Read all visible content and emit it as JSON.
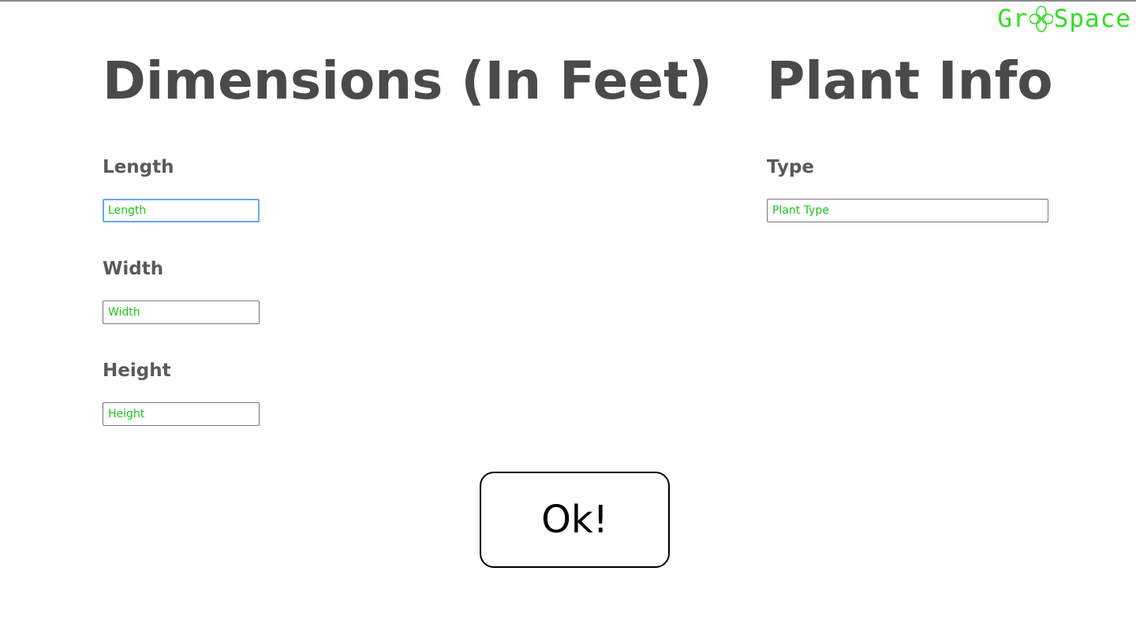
{
  "logo": {
    "text_before": "Gr",
    "text_after": "Space",
    "color": "#33dd22",
    "icon": "flower-icon"
  },
  "dimensions": {
    "title": "Dimensions (In Feet)",
    "length": {
      "label": "Length",
      "placeholder": "Length",
      "value": ""
    },
    "width": {
      "label": "Width",
      "placeholder": "Width",
      "value": ""
    },
    "height": {
      "label": "Height",
      "placeholder": "Height",
      "value": ""
    }
  },
  "plant_info": {
    "title": "Plant Info",
    "type": {
      "label": "Type",
      "placeholder": "Plant Type",
      "value": ""
    }
  },
  "ok_button": {
    "label": "Ok!"
  },
  "colors": {
    "accent_green": "#1cc41c",
    "heading": "#4a4a4a",
    "focus_ring": "#6aa8f0"
  }
}
